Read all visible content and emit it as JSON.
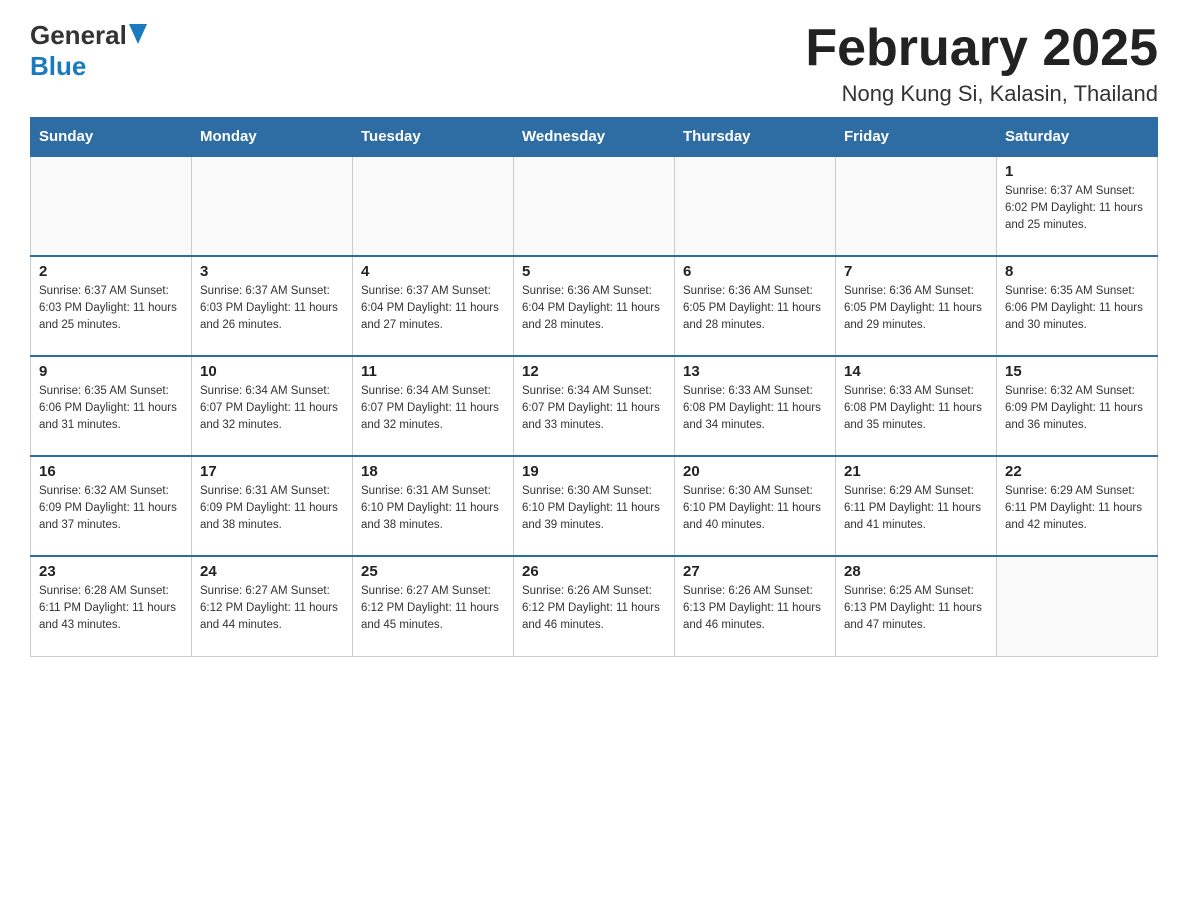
{
  "logo": {
    "general": "General",
    "blue": "Blue"
  },
  "title": {
    "month_year": "February 2025",
    "location": "Nong Kung Si, Kalasin, Thailand"
  },
  "days_of_week": [
    "Sunday",
    "Monday",
    "Tuesday",
    "Wednesday",
    "Thursday",
    "Friday",
    "Saturday"
  ],
  "weeks": [
    [
      {
        "day": "",
        "info": ""
      },
      {
        "day": "",
        "info": ""
      },
      {
        "day": "",
        "info": ""
      },
      {
        "day": "",
        "info": ""
      },
      {
        "day": "",
        "info": ""
      },
      {
        "day": "",
        "info": ""
      },
      {
        "day": "1",
        "info": "Sunrise: 6:37 AM\nSunset: 6:02 PM\nDaylight: 11 hours and 25 minutes."
      }
    ],
    [
      {
        "day": "2",
        "info": "Sunrise: 6:37 AM\nSunset: 6:03 PM\nDaylight: 11 hours and 25 minutes."
      },
      {
        "day": "3",
        "info": "Sunrise: 6:37 AM\nSunset: 6:03 PM\nDaylight: 11 hours and 26 minutes."
      },
      {
        "day": "4",
        "info": "Sunrise: 6:37 AM\nSunset: 6:04 PM\nDaylight: 11 hours and 27 minutes."
      },
      {
        "day": "5",
        "info": "Sunrise: 6:36 AM\nSunset: 6:04 PM\nDaylight: 11 hours and 28 minutes."
      },
      {
        "day": "6",
        "info": "Sunrise: 6:36 AM\nSunset: 6:05 PM\nDaylight: 11 hours and 28 minutes."
      },
      {
        "day": "7",
        "info": "Sunrise: 6:36 AM\nSunset: 6:05 PM\nDaylight: 11 hours and 29 minutes."
      },
      {
        "day": "8",
        "info": "Sunrise: 6:35 AM\nSunset: 6:06 PM\nDaylight: 11 hours and 30 minutes."
      }
    ],
    [
      {
        "day": "9",
        "info": "Sunrise: 6:35 AM\nSunset: 6:06 PM\nDaylight: 11 hours and 31 minutes."
      },
      {
        "day": "10",
        "info": "Sunrise: 6:34 AM\nSunset: 6:07 PM\nDaylight: 11 hours and 32 minutes."
      },
      {
        "day": "11",
        "info": "Sunrise: 6:34 AM\nSunset: 6:07 PM\nDaylight: 11 hours and 32 minutes."
      },
      {
        "day": "12",
        "info": "Sunrise: 6:34 AM\nSunset: 6:07 PM\nDaylight: 11 hours and 33 minutes."
      },
      {
        "day": "13",
        "info": "Sunrise: 6:33 AM\nSunset: 6:08 PM\nDaylight: 11 hours and 34 minutes."
      },
      {
        "day": "14",
        "info": "Sunrise: 6:33 AM\nSunset: 6:08 PM\nDaylight: 11 hours and 35 minutes."
      },
      {
        "day": "15",
        "info": "Sunrise: 6:32 AM\nSunset: 6:09 PM\nDaylight: 11 hours and 36 minutes."
      }
    ],
    [
      {
        "day": "16",
        "info": "Sunrise: 6:32 AM\nSunset: 6:09 PM\nDaylight: 11 hours and 37 minutes."
      },
      {
        "day": "17",
        "info": "Sunrise: 6:31 AM\nSunset: 6:09 PM\nDaylight: 11 hours and 38 minutes."
      },
      {
        "day": "18",
        "info": "Sunrise: 6:31 AM\nSunset: 6:10 PM\nDaylight: 11 hours and 38 minutes."
      },
      {
        "day": "19",
        "info": "Sunrise: 6:30 AM\nSunset: 6:10 PM\nDaylight: 11 hours and 39 minutes."
      },
      {
        "day": "20",
        "info": "Sunrise: 6:30 AM\nSunset: 6:10 PM\nDaylight: 11 hours and 40 minutes."
      },
      {
        "day": "21",
        "info": "Sunrise: 6:29 AM\nSunset: 6:11 PM\nDaylight: 11 hours and 41 minutes."
      },
      {
        "day": "22",
        "info": "Sunrise: 6:29 AM\nSunset: 6:11 PM\nDaylight: 11 hours and 42 minutes."
      }
    ],
    [
      {
        "day": "23",
        "info": "Sunrise: 6:28 AM\nSunset: 6:11 PM\nDaylight: 11 hours and 43 minutes."
      },
      {
        "day": "24",
        "info": "Sunrise: 6:27 AM\nSunset: 6:12 PM\nDaylight: 11 hours and 44 minutes."
      },
      {
        "day": "25",
        "info": "Sunrise: 6:27 AM\nSunset: 6:12 PM\nDaylight: 11 hours and 45 minutes."
      },
      {
        "day": "26",
        "info": "Sunrise: 6:26 AM\nSunset: 6:12 PM\nDaylight: 11 hours and 46 minutes."
      },
      {
        "day": "27",
        "info": "Sunrise: 6:26 AM\nSunset: 6:13 PM\nDaylight: 11 hours and 46 minutes."
      },
      {
        "day": "28",
        "info": "Sunrise: 6:25 AM\nSunset: 6:13 PM\nDaylight: 11 hours and 47 minutes."
      },
      {
        "day": "",
        "info": ""
      }
    ]
  ]
}
